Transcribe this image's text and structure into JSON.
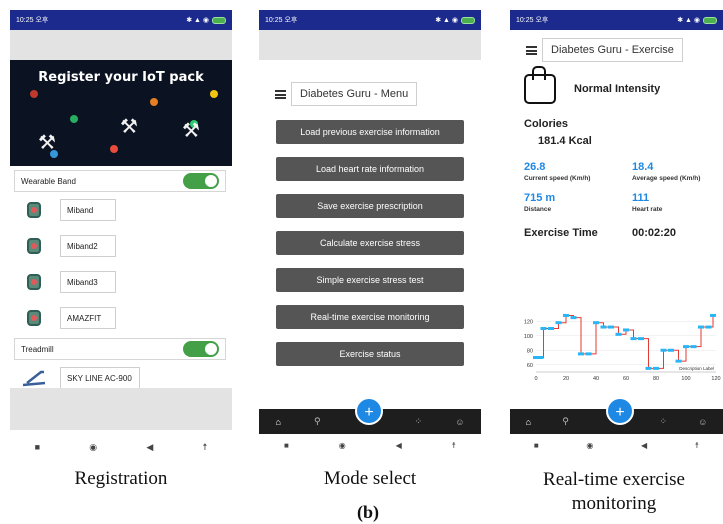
{
  "status_bar": {
    "time": "10:25 오후"
  },
  "registration": {
    "banner_title": "Register your IoT pack",
    "wearable_label": "Wearable Band",
    "devices": [
      "Miband",
      "Miband2",
      "Miband3",
      "AMAZFIT"
    ],
    "treadmill_label": "Treadmill",
    "treadmill_device": "SKY LINE AC-900",
    "wearable_enabled": true,
    "treadmill_enabled": true
  },
  "menu": {
    "title": "Diabetes Guru - Menu",
    "items": [
      "Load previous exercise information",
      "Load heart rate information",
      "Save exercise prescription",
      "Calculate exercise stress",
      "Simple exercise stress test",
      "Real-time exercise monitoring",
      "Exercise status"
    ]
  },
  "monitor": {
    "title": "Diabetes Guru - Exercise",
    "intensity": "Normal Intensity",
    "calories_label": "Colories",
    "calories_value": "181.4 Kcal",
    "current_speed_value": "26.8",
    "current_speed_label": "Current speed (Km/h)",
    "average_speed_value": "18.4",
    "average_speed_label": "Average speed (Km/h)",
    "distance_value": "715 m",
    "distance_label": "Distance",
    "heart_rate_value": "111",
    "heart_rate_label": "Heart rate",
    "exercise_time_label": "Exercise Time",
    "exercise_time_value": "00:02:20"
  },
  "chart_data": {
    "type": "line",
    "step": true,
    "x": [
      0,
      3,
      5,
      10,
      15,
      20,
      25,
      30,
      35,
      40,
      45,
      50,
      55,
      60,
      65,
      70,
      75,
      80,
      85,
      90,
      95,
      100,
      105,
      110,
      115,
      118
    ],
    "y": [
      70,
      70,
      110,
      110,
      118,
      128,
      125,
      75,
      75,
      118,
      112,
      112,
      102,
      108,
      96,
      96,
      55,
      55,
      80,
      80,
      65,
      85,
      85,
      112,
      112,
      128
    ],
    "xticks": [
      0,
      20,
      40,
      60,
      80,
      100,
      120
    ],
    "yticks": [
      60,
      80,
      100,
      120
    ],
    "xlim": [
      0,
      120
    ],
    "ylim": [
      50,
      130
    ],
    "legend": "Description Label",
    "colors": {
      "line": "#e53935",
      "points": "#29b6f6"
    }
  },
  "captions": {
    "registration": "Registration",
    "mode_select": "Mode select",
    "monitoring": "Real-time exercise monitoring",
    "figure_label": "(b)"
  }
}
